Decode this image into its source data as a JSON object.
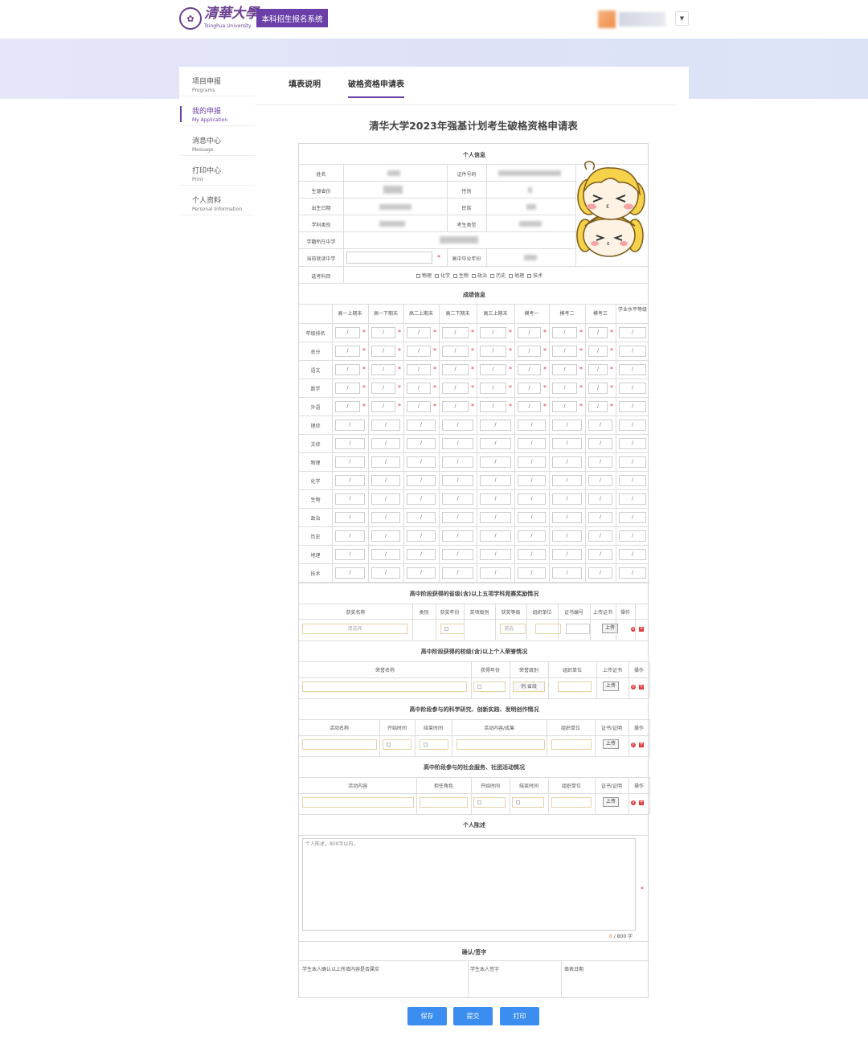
{
  "header": {
    "logo_text": "清華大學",
    "logo_sub": "Tsinghua University",
    "system_badge": "本科招生报名系统"
  },
  "sidebar": {
    "items": [
      {
        "cn": "项目申报",
        "en": "Programs"
      },
      {
        "cn": "我的申报",
        "en": "My Application"
      },
      {
        "cn": "消息中心",
        "en": "Message"
      },
      {
        "cn": "打印中心",
        "en": "Print"
      },
      {
        "cn": "个人资料",
        "en": "Personal Information"
      }
    ]
  },
  "tabs": [
    "填表说明",
    "破格资格申请表"
  ],
  "form_title": "清华大学2023年强基计划考生破格资格申请表",
  "personal": {
    "section": "个人信息",
    "name_label": "姓名",
    "id_label": "证件号码",
    "province_label": "生源省份",
    "gender_label": "性别",
    "birth_label": "出生日期",
    "ethnic_label": "民族",
    "category_label": "学科类别",
    "type_label": "考生类型",
    "school_label": "学籍所在中学",
    "current_school_label": "当前就读中学",
    "grad_year_label": "高中毕业年份",
    "subjects_label": "选考科目",
    "subjects": [
      "物理",
      "化学",
      "生物",
      "政治",
      "历史",
      "地理",
      "技术"
    ]
  },
  "grades": {
    "section": "成绩信息",
    "columns": [
      "高一上期末",
      "高一下期末",
      "高二上期末",
      "高二下期末",
      "高三上期末",
      "模考一",
      "模考二",
      "模考三",
      "学业水平等级"
    ],
    "rows": [
      "年级排名",
      "总分",
      "语文",
      "数学",
      "外语",
      "理综",
      "文综",
      "物理",
      "化学",
      "生物",
      "政治",
      "历史",
      "地理",
      "技术"
    ],
    "placeholder": "/"
  },
  "competition": {
    "section": "高中阶段获得的省级(含)以上五项学科竞赛奖励情况",
    "headers": [
      "获奖名称",
      "类别",
      "获奖年份",
      "奖项级别",
      "获奖等级",
      "组织单位",
      "证书编号",
      "上传证书",
      "操作"
    ],
    "select_placeholder": "请选择",
    "level_placeholder": "请选"
  },
  "honor": {
    "section": "高中阶段获得的校级(含)以上个人荣誉情况",
    "headers": [
      "荣誉名称",
      "获得年份",
      "荣誉级别",
      "组织单位",
      "上传证书",
      "操作"
    ],
    "level_placeholder": "例:省级"
  },
  "research": {
    "section": "高中阶段参与的科学研究、创新实践、发明创作情况",
    "headers": [
      "活动名称",
      "开始时间",
      "结束时间",
      "活动内容/成果",
      "组织单位",
      "证书/证明",
      "操作"
    ]
  },
  "service": {
    "section": "高中阶段参与的社会服务、社团活动情况",
    "headers": [
      "活动内容",
      "担任角色",
      "开始时间",
      "结束时间",
      "组织单位",
      "证书/证明",
      "操作"
    ]
  },
  "statement": {
    "section": "个人陈述",
    "placeholder": "个人陈述，800字以内。",
    "counter_current": "0",
    "counter_max": "/ 800 字"
  },
  "confirm": {
    "section": "确认/签字",
    "declaration": "学生本人确认以上所填内容是否属实",
    "signature": "学生本人签字",
    "date": "填表日期"
  },
  "upload_label": "上传",
  "buttons": {
    "save": "保存",
    "submit": "提交",
    "print": "打印"
  },
  "colors": {
    "accent": "#6a40a8",
    "button": "#3b8ef0",
    "required": "#e23b3b"
  }
}
